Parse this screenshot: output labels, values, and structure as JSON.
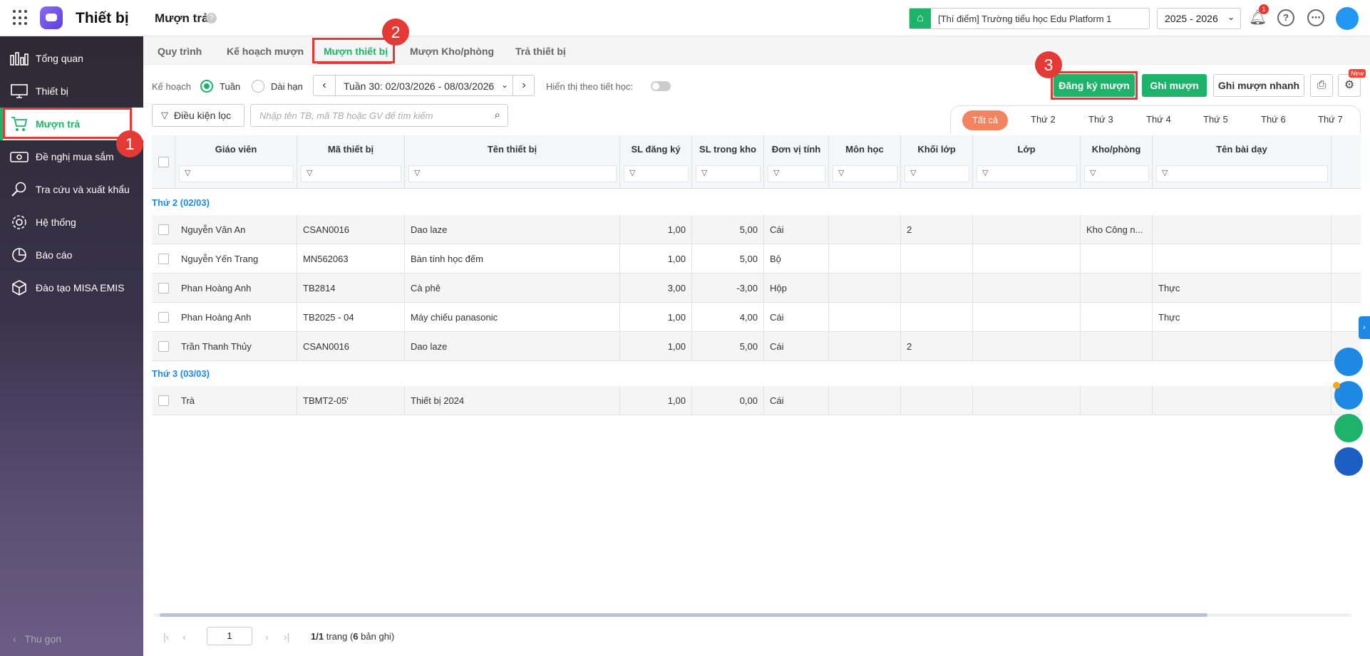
{
  "app": {
    "title": "Thiết bị"
  },
  "page": {
    "title": "Mượn trả",
    "help": "?"
  },
  "header": {
    "school": "[Thí điểm] Trường tiểu học Edu Platform 1",
    "year": "2025 - 2026",
    "notif_count": "1"
  },
  "sidebar": {
    "items": [
      {
        "label": "Tổng quan",
        "icon": "dashboard-icon"
      },
      {
        "label": "Thiết bị",
        "icon": "monitor-icon"
      },
      {
        "label": "Mượn trả",
        "icon": "cart-icon",
        "active": true
      },
      {
        "label": "Đề nghị mua sắm",
        "icon": "money-icon"
      },
      {
        "label": "Tra cứu và xuất khẩu",
        "icon": "search-icon"
      },
      {
        "label": "Hệ thống",
        "icon": "gear-icon"
      },
      {
        "label": "Báo cáo",
        "icon": "pie-chart-icon"
      },
      {
        "label": "Đào tạo MISA EMIS",
        "icon": "box-icon"
      }
    ],
    "collapse": "Thu gọn"
  },
  "tabs": [
    "Quy trình",
    "Kế hoạch mượn",
    "Mượn thiết bị",
    "Mượn Kho/phòng",
    "Trả thiết bị"
  ],
  "annotations": [
    "1",
    "2",
    "3"
  ],
  "toolbar": {
    "plan_label": "Kế hoạch",
    "radio_week": "Tuần",
    "radio_long": "Dài hạn",
    "week_value": "Tuần 30: 02/03/2026 - 08/03/2026",
    "show_by_period": "Hiển thị theo tiết học:",
    "register_btn": "Đăng ký mượn",
    "borrow_btn": "Ghi mượn",
    "quick_borrow_btn": "Ghi mượn nhanh",
    "new_tag": "New",
    "filter_btn": "Điều kiện lọc",
    "search_placeholder": "Nhập tên TB, mã TB hoặc GV để tìm kiếm"
  },
  "day_tabs": [
    "Tất cả",
    "Thứ 2",
    "Thứ 3",
    "Thứ 4",
    "Thứ 5",
    "Thứ 6",
    "Thứ 7"
  ],
  "table": {
    "columns": [
      "Giáo viên",
      "Mã thiết bị",
      "Tên thiết bị",
      "SL đăng ký",
      "SL trong kho",
      "Đơn vị tính",
      "Môn học",
      "Khối lớp",
      "Lớp",
      "Kho/phòng",
      "Tên bài dạy"
    ],
    "groups": [
      {
        "title": "Thứ 2 (02/03)",
        "rows": [
          {
            "teacher": "Nguyễn Văn An",
            "code": "CSAN0016",
            "name": "Dao laze",
            "reg": "1,00",
            "stock": "5,00",
            "unit": "Cái",
            "subject": "",
            "grade": "2",
            "cls": "",
            "room": "Kho Công n...",
            "lesson": ""
          },
          {
            "teacher": "Nguyễn Yến Trang",
            "code": "MN562063",
            "name": "Bàn tính học đếm",
            "reg": "1,00",
            "stock": "5,00",
            "unit": "Bộ",
            "subject": "",
            "grade": "",
            "cls": "",
            "room": "",
            "lesson": ""
          },
          {
            "teacher": "Phan Hoàng Anh",
            "code": "TB2814",
            "name": "Cà phê",
            "reg": "3,00",
            "stock": "-3,00",
            "unit": "Hộp",
            "subject": "",
            "grade": "",
            "cls": "",
            "room": "",
            "lesson": "Thực"
          },
          {
            "teacher": "Phan Hoàng Anh",
            "code": "TB2025 - 04",
            "name": "Máy chiếu panasonic",
            "reg": "1,00",
            "stock": "4,00",
            "unit": "Cái",
            "subject": "",
            "grade": "",
            "cls": "",
            "room": "",
            "lesson": "Thực"
          },
          {
            "teacher": "Trần Thanh Thủy",
            "code": "CSAN0016",
            "name": "Dao laze",
            "reg": "1,00",
            "stock": "5,00",
            "unit": "Cái",
            "subject": "",
            "grade": "2",
            "cls": "",
            "room": "",
            "lesson": ""
          }
        ]
      },
      {
        "title": "Thứ 3 (03/03)",
        "rows": [
          {
            "teacher": "Trà",
            "code": "TBMT2-05'",
            "name": "Thiết bị 2024",
            "reg": "1,00",
            "stock": "0,00",
            "unit": "Cái",
            "subject": "",
            "grade": "",
            "cls": "",
            "room": "",
            "lesson": ""
          }
        ]
      }
    ]
  },
  "pager": {
    "page": "1",
    "pages": "1/1",
    "word_page": "trang",
    "records": "6",
    "word_records": "bản ghi"
  },
  "colors": {
    "accent": "#1db36b",
    "annotation": "#e53935",
    "group": "#1e88e5"
  }
}
